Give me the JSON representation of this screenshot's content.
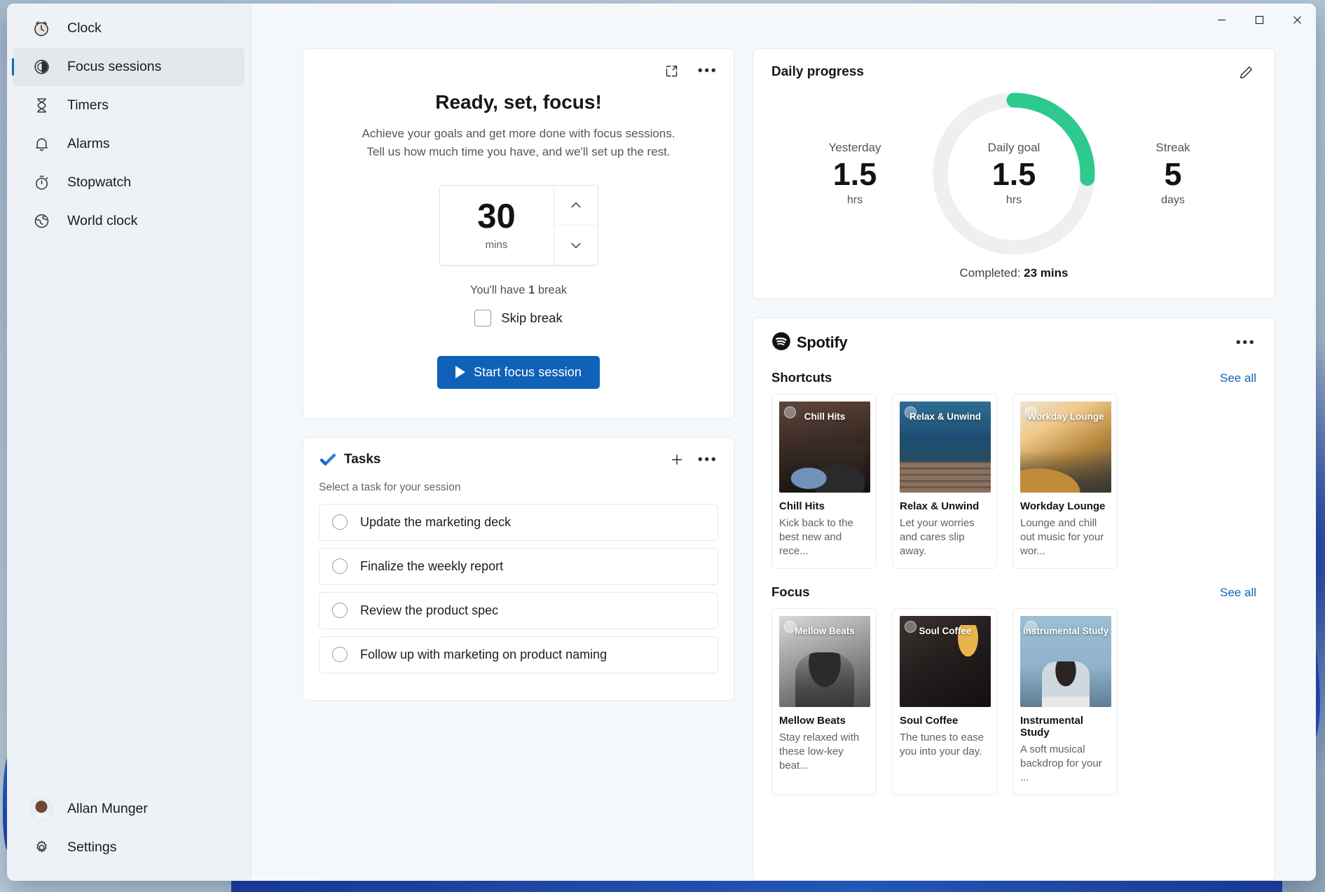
{
  "window": {
    "controls": {
      "minimize": "Minimize",
      "maximize": "Maximize",
      "close": "Close"
    }
  },
  "sidebar": {
    "app_title": "Clock",
    "items": [
      {
        "label": "Focus sessions",
        "icon": "focus-sessions-icon",
        "selected": true
      },
      {
        "label": "Timers",
        "icon": "hourglass-icon",
        "selected": false
      },
      {
        "label": "Alarms",
        "icon": "bell-icon",
        "selected": false
      },
      {
        "label": "Stopwatch",
        "icon": "stopwatch-icon",
        "selected": false
      },
      {
        "label": "World clock",
        "icon": "globe-icon",
        "selected": false
      }
    ],
    "account_name": "Allan Munger",
    "settings_label": "Settings"
  },
  "focus_card": {
    "title": "Ready, set, focus!",
    "subtitle_line1": "Achieve your goals and get more done with focus sessions.",
    "subtitle_line2": "Tell us how much time you have, and we'll set up the rest.",
    "minutes_value": "30",
    "minutes_unit": "mins",
    "break_text_prefix": "You'll have ",
    "break_count": "1",
    "break_text_suffix": " break",
    "skip_break_label": "Skip break",
    "skip_break_checked": false,
    "start_button_label": "Start focus session",
    "accent_color": "#0f62b8"
  },
  "tasks_card": {
    "title": "Tasks",
    "hint": "Select a task for your session",
    "add_label": "Add task",
    "more_label": "More options",
    "items": [
      {
        "label": "Update the marketing deck",
        "done": false
      },
      {
        "label": "Finalize the weekly report",
        "done": false
      },
      {
        "label": "Review the product spec",
        "done": false
      },
      {
        "label": "Follow up with marketing on product naming",
        "done": false
      }
    ]
  },
  "progress_card": {
    "title": "Daily progress",
    "edit_label": "Edit daily goal",
    "ring_color": "#2DC98D",
    "ring_track_color": "#efeff1",
    "yesterday": {
      "label": "Yesterday",
      "value": "1.5",
      "unit": "hrs"
    },
    "goal": {
      "label": "Daily goal",
      "value": "1.5",
      "unit": "hrs"
    },
    "streak": {
      "label": "Streak",
      "value": "5",
      "unit": "days"
    },
    "completed_label": "Completed:",
    "completed_value": "23 mins",
    "progress_percent": 26
  },
  "spotify_card": {
    "brand": "Spotify",
    "more_label": "More options",
    "sections": [
      {
        "title": "Shortcuts",
        "see_all": "See all",
        "tiles": [
          {
            "art_title": "Chill Hits",
            "art_class": "art-chill",
            "name": "Chill Hits",
            "desc": "Kick back to the best new and rece..."
          },
          {
            "art_title": "Relax & Unwind",
            "art_class": "art-relax",
            "name": "Relax & Unwind",
            "desc": "Let your worries and cares slip away."
          },
          {
            "art_title": "Workday Lounge",
            "art_class": "art-workday",
            "name": "Workday Lounge",
            "desc": "Lounge and chill out music for your wor..."
          }
        ]
      },
      {
        "title": "Focus",
        "see_all": "See all",
        "tiles": [
          {
            "art_title": "Mellow Beats",
            "art_class": "art-mellow",
            "name": "Mellow  Beats",
            "desc": "Stay relaxed with these low-key beat..."
          },
          {
            "art_title": "Soul Coffee",
            "art_class": "art-soul",
            "name": "Soul Coffee",
            "desc": "The tunes to ease you into your day."
          },
          {
            "art_title": "Instrumental Study",
            "art_class": "art-instr",
            "name": "Instrumental Study",
            "desc": "A soft musical backdrop for your ..."
          }
        ]
      }
    ]
  }
}
